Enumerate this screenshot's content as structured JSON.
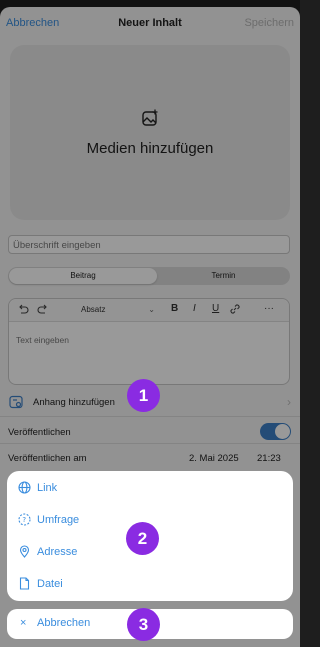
{
  "header": {
    "cancel": "Abbrechen",
    "title": "Neuer Inhalt",
    "save": "Speichern"
  },
  "media": {
    "label": "Medien hinzufügen",
    "icon": "add-image-icon"
  },
  "headline": {
    "placeholder": "Überschrift eingeben"
  },
  "segment": {
    "tabs": [
      "Beitrag",
      "Termin"
    ],
    "selected": "Beitrag"
  },
  "editor": {
    "paragraph_select": "Absatz",
    "bold": "B",
    "italic": "I",
    "underline": "U",
    "more": "···",
    "placeholder": "Text eingeben"
  },
  "attachment": {
    "label": "Anhang hinzufügen"
  },
  "publish": {
    "label": "Veröffentlichen",
    "enabled": true
  },
  "publish_at": {
    "label": "Veröffentlichen am",
    "date": "2. Mai 2025",
    "time": "21:23"
  },
  "action_sheet": {
    "items": [
      {
        "label": "Link",
        "icon": "globe-icon"
      },
      {
        "label": "Umfrage",
        "icon": "poll-icon"
      },
      {
        "label": "Adresse",
        "icon": "location-pin-icon"
      },
      {
        "label": "Datei",
        "icon": "file-icon"
      }
    ],
    "cancel": "Abbrechen"
  },
  "markers": [
    "1",
    "2",
    "3"
  ],
  "colors": {
    "accent": "#3a8dde",
    "toggle": "#3d7fc6",
    "marker": "#8a2be2"
  }
}
